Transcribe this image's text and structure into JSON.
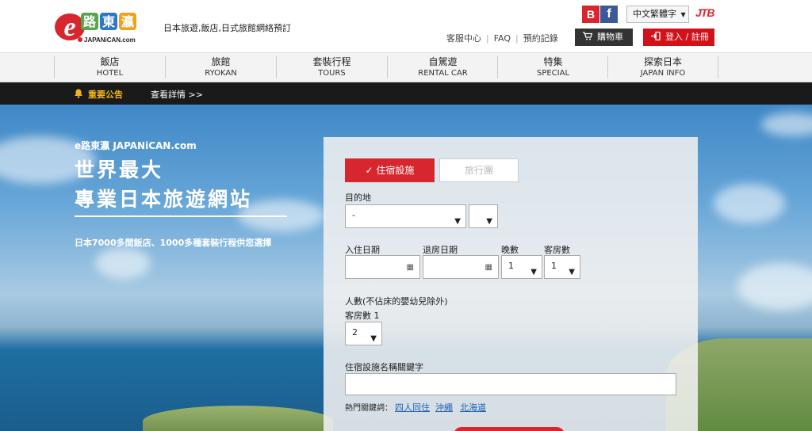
{
  "header": {
    "tagline": "日本旅遊,飯店,日式旅館網絡預訂",
    "sns_b": "B",
    "sns_f": "f",
    "language": "中文繁體字",
    "jtb": "JTB",
    "links": [
      "客服中心",
      "FAQ",
      "預約記錄"
    ],
    "cart_label": "購物車",
    "login_label": "登入 / 註冊"
  },
  "nav": [
    {
      "zh": "飯店",
      "en": "HOTEL"
    },
    {
      "zh": "旅館",
      "en": "RYOKAN"
    },
    {
      "zh": "套裝行程",
      "en": "TOURS"
    },
    {
      "zh": "自駕遊",
      "en": "RENTAL CAR"
    },
    {
      "zh": "特集",
      "en": "SPECIAL"
    },
    {
      "zh": "探索日本",
      "en": "JAPAN INFO"
    }
  ],
  "notice": {
    "label": "重要公告",
    "link": "查看詳情 >>"
  },
  "hero": {
    "brand": "e路東瀛 JAPANiCAN.com",
    "title_line1": "世界最大",
    "title_line2": "專業日本旅遊網站",
    "subtitle": "日本7000多間飯店、1000多種套裝行程供您選擇"
  },
  "search": {
    "tab_hotel": "住宿設施",
    "tab_tour": "旅行團",
    "destination_label": "目的地",
    "destination_value": "-",
    "checkin_label": "入住日期",
    "checkout_label": "退房日期",
    "nights_label": "晚數",
    "nights_value": "1",
    "rooms_label": "客房數",
    "rooms_value": "1",
    "persons_label": "人數(不佔床的嬰幼兒除外)",
    "room1_label": "客房數 1",
    "room1_value": "2",
    "keyword_label": "住宿設施名稱關鍵字",
    "hot_keywords_label": "熱門關鍵詞：",
    "hot_keywords": [
      "四人同住",
      "沖繩",
      "北海道"
    ]
  },
  "colors": {
    "brand_red": "#d8262f",
    "dark": "#1a1a1a",
    "notice_gold": "#f3b21b",
    "link_blue": "#1f5fb0"
  }
}
